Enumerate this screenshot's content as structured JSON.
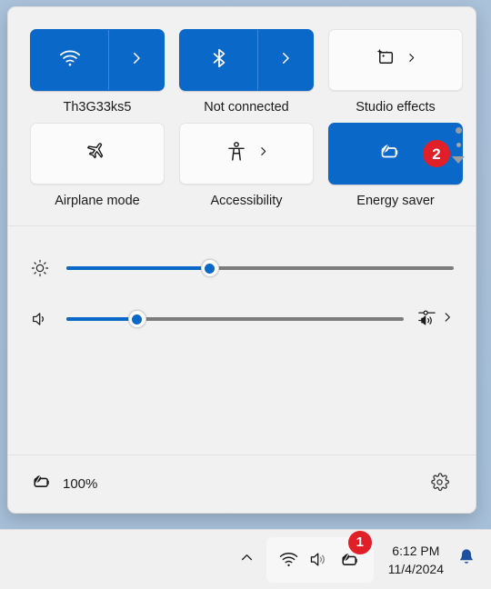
{
  "theme": {
    "accent": "#0a68c8",
    "badge_red": "#e11f28",
    "panel_bg": "#f1f1f1",
    "tile_off_bg": "#fbfbfb",
    "track_bg": "#7c7c7c",
    "text": "#1b1b1b",
    "desktop_bg": "#a8c0d8"
  },
  "quick_settings": {
    "tiles": [
      {
        "id": "wifi",
        "label": "Th3G33ks5",
        "icon": "wifi-icon",
        "state": "on",
        "has_chevron": true,
        "split": true,
        "badge": null
      },
      {
        "id": "bluetooth",
        "label": "Not connected",
        "icon": "bluetooth-icon",
        "state": "on",
        "has_chevron": true,
        "split": true,
        "badge": null
      },
      {
        "id": "studio-effects",
        "label": "Studio effects",
        "icon": "studio-effects-icon",
        "state": "off",
        "has_chevron": true,
        "split": false,
        "badge": null
      },
      {
        "id": "airplane-mode",
        "label": "Airplane mode",
        "icon": "airplane-icon",
        "state": "off",
        "has_chevron": false,
        "split": false,
        "badge": null
      },
      {
        "id": "accessibility",
        "label": "Accessibility",
        "icon": "accessibility-icon",
        "state": "off",
        "has_chevron": true,
        "split": false,
        "badge": null
      },
      {
        "id": "energy-saver",
        "label": "Energy saver",
        "icon": "energy-saver-icon",
        "state": "on",
        "has_chevron": false,
        "split": false,
        "badge": "2"
      }
    ],
    "pager": {
      "page_dots": 2,
      "expand_icon": "chevron-down-icon"
    },
    "sliders": [
      {
        "id": "brightness",
        "icon": "brightness-icon",
        "value": 37,
        "trailing_icon": null,
        "trailing_chevron": false
      },
      {
        "id": "volume",
        "icon": "volume-icon",
        "value": 21,
        "trailing_icon": "audio-output-picker-icon",
        "trailing_chevron": true
      }
    ],
    "footer": {
      "battery_icon": "battery-saver-icon",
      "battery_percent": "100%",
      "settings_icon": "gear-icon"
    }
  },
  "taskbar": {
    "show_hidden_icons": "chevron-up-icon",
    "tray_icons": [
      {
        "id": "wifi",
        "icon": "wifi-icon"
      },
      {
        "id": "volume",
        "icon": "volume-icon"
      },
      {
        "id": "battery",
        "icon": "battery-saver-icon"
      }
    ],
    "tray_badge": "1",
    "clock": {
      "time": "6:12 PM",
      "date": "11/4/2024"
    },
    "notification_icon": "bell-icon"
  }
}
